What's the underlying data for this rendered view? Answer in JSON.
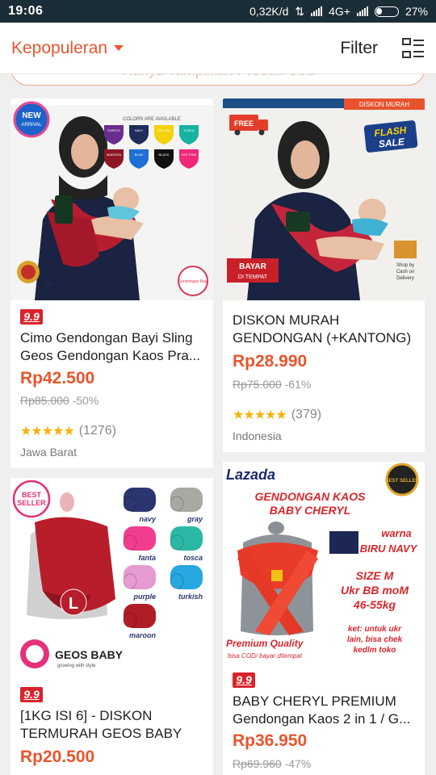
{
  "status": {
    "time": "19:06",
    "speed": "0,32K/d",
    "network": "4G+",
    "battery": "27%"
  },
  "header": {
    "sort_label": "Kepopuleran",
    "filter_label": "Filter"
  },
  "notice": {
    "text": "Hanya Tampilkan Produk Cod"
  },
  "products": [
    {
      "badge": "9.9",
      "title": "Cimo Gendongan Bayi Sling Geos Gendongan Kaos Pra...",
      "price": "Rp42.500",
      "old_price": "Rp85.000",
      "discount": "-50%",
      "stars": "★★★★★",
      "reviews": "(1276)",
      "location": "Jawa Barat",
      "image": {
        "new_arrival": [
          "NEW",
          "ARRIVAL"
        ],
        "colors_heading": "COLORS ARE AVAILABLE",
        "colors": [
          {
            "label": "PURPLE",
            "hex": "#6a2c8f"
          },
          {
            "label": "NAVY",
            "hex": "#1f2d5c"
          },
          {
            "label": "YELLOW",
            "hex": "#f2d20a"
          },
          {
            "label": "TOSCA",
            "hex": "#17b3a0"
          },
          {
            "label": "MAROON",
            "hex": "#8f1626"
          },
          {
            "label": "BLUE",
            "hex": "#1e6fd6"
          },
          {
            "label": "BLACK",
            "hex": "#111111"
          },
          {
            "label": "HOT PINK",
            "hex": "#f0287a"
          }
        ],
        "stamp_text": "Gendongan Bayi",
        "award_text": "TOP"
      }
    },
    {
      "title": "DISKON MURAH GENDONGAN (+KANTONG) ...",
      "price": "Rp28.990",
      "old_price": "Rp75.000",
      "discount": "-61%",
      "stars": "★★★★★",
      "reviews": "(379)",
      "location": "Indonesia",
      "image": {
        "banner": "DISKON MURAH",
        "free_label": "FREE",
        "flash": [
          "FLASH",
          "SALE"
        ],
        "cod": [
          "BAYAR",
          "DI TEMPAT"
        ],
        "shop_cod": [
          "Shop by",
          "Cash on",
          "Delivery"
        ]
      }
    },
    {
      "badge": "9.9",
      "title": "[1KG ISI 6] - DISKON TERMURAH GEOS BABY GE...",
      "price": "Rp20.500",
      "image": {
        "best_seller": [
          "BEST",
          "SELLER"
        ],
        "size_letter": "L",
        "brand": "GEOS BABY",
        "tagline": "growing with style",
        "colors": [
          {
            "label": "navy",
            "hex": "#2b3670"
          },
          {
            "label": "gray",
            "hex": "#a9a9a2"
          },
          {
            "label": "fanta",
            "hex": "#f23c8d"
          },
          {
            "label": "tosca",
            "hex": "#2ab8a4"
          },
          {
            "label": "purple",
            "hex": "#e59ad1"
          },
          {
            "label": "turkish",
            "hex": "#27a6e0"
          },
          {
            "label": "maroon",
            "hex": "#b01d27"
          }
        ]
      }
    },
    {
      "badge": "9.9",
      "title": "BABY CHERYL PREMIUM Gendongan Kaos 2 in 1 / G...",
      "price": "Rp36.950",
      "old_price": "Rp69.960",
      "discount": "-47%",
      "image": {
        "store_logo": "Lazada",
        "headline": [
          "GENDONGAN KAOS",
          "BABY CHERYL"
        ],
        "warna": "warna",
        "warna_name": "BIRU NAVY",
        "size": [
          "SIZE M",
          "Ukr BB moM",
          "46-55kg"
        ],
        "ket": [
          "ket: untuk ukr",
          "lain, bisa chek",
          "kedlm toko"
        ],
        "premium": "Premium Quality",
        "cod_note": "bisa COD/ bayar ditempat",
        "best_seller": "BEST SELLER",
        "swatch_hex": "#1d2754"
      }
    }
  ]
}
